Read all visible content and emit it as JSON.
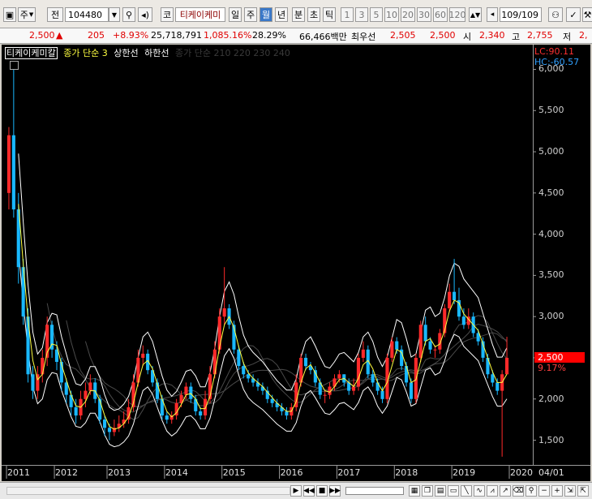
{
  "toolbar": {
    "code_type": "주",
    "market": "전",
    "stock_code": "104480",
    "name_type": "코",
    "stock_name": "티케이케미",
    "periods": [
      "일",
      "주",
      "월",
      "년",
      "분",
      "초",
      "틱"
    ],
    "selected_period": "월",
    "minute_options": [
      "1",
      "3",
      "5",
      "10",
      "20",
      "30",
      "60",
      "120"
    ],
    "count": "109",
    "count_total": "/109"
  },
  "quote": {
    "price": "2,500",
    "arrow": "▲",
    "change": "205",
    "change_pct": "+8.93%",
    "volume": "25,718,791",
    "volume_ratio": "1,085.16%",
    "turnover": "28.29%",
    "amount": "66,466백만",
    "label_lowest": "최우선",
    "bid": "2,505",
    "ask": "2,500",
    "label_open": "시",
    "open": "2,340",
    "label_high": "고",
    "high": "2,755",
    "label_low": "저",
    "low": "2,"
  },
  "legend": {
    "stock": "티케이케미칼",
    "ma_label": "종가 단순 3",
    "upper": "상한선",
    "lower": "하한선",
    "ma_group": "종가 단순 210 220 230 240"
  },
  "indicators": {
    "lc": "LC:90.11",
    "hc": "HC:-60.57",
    "price_tag": "2,500",
    "pct_tag": "9.17%"
  },
  "colors": {
    "up": "#ff2a2a",
    "down": "#19b8ff",
    "band": "#ffffff",
    "ma": "#ffff40",
    "price_tag_bg": "#ff0000"
  },
  "footer": {
    "date_label": "04/01"
  },
  "chart_data": {
    "type": "candlestick",
    "ylim": [
      1200,
      6300
    ],
    "y_ticks": [
      "6,000",
      "5,500",
      "5,000",
      "4,500",
      "4,000",
      "3,500",
      "3,000",
      "2,500",
      "2,000",
      "1,500"
    ],
    "y_tick_values": [
      6000,
      5500,
      5000,
      4500,
      4000,
      3500,
      3000,
      2500,
      2000,
      1500
    ],
    "x_labels": [
      "2011",
      "2012",
      "2013",
      "2014",
      "2015",
      "2016",
      "2017",
      "2018",
      "2019",
      "2020"
    ],
    "x_label_index": [
      0,
      10,
      21,
      33,
      45,
      57,
      69,
      81,
      93,
      105
    ],
    "open": [
      4500,
      5200,
      4300,
      3600,
      3000,
      2300,
      2100,
      2300,
      2500,
      2900,
      2600,
      2450,
      2200,
      2050,
      1900,
      1800,
      2000,
      2100,
      2200,
      2000,
      1750,
      1650,
      1600,
      1650,
      1700,
      1750,
      1900,
      2200,
      2500,
      2550,
      2350,
      2200,
      2000,
      1800,
      1750,
      1800,
      1950,
      2050,
      2150,
      2000,
      1850,
      1800,
      2000,
      2300,
      2600,
      3000,
      3100,
      2900,
      2600,
      2400,
      2300,
      2250,
      2200,
      2150,
      2100,
      2000,
      1950,
      1900,
      1850,
      1800,
      1900,
      2200,
      2500,
      2400,
      2350,
      2200,
      2050,
      2050,
      2150,
      2250,
      2300,
      2200,
      2100,
      2150,
      2500,
      2600,
      2300,
      2200,
      2100,
      2000,
      2500,
      2700,
      2600,
      2400,
      2200,
      2000,
      2500,
      2900,
      2700,
      2600,
      2600,
      2800,
      3100,
      3300,
      3200,
      3000,
      2900,
      3000,
      2800,
      2700,
      2500,
      2300,
      2200,
      2100,
      2300
    ],
    "close": [
      5200,
      4300,
      3600,
      3000,
      2300,
      2100,
      2300,
      2500,
      2900,
      2600,
      2450,
      2200,
      2050,
      1900,
      1800,
      2000,
      2100,
      2200,
      2000,
      1750,
      1650,
      1600,
      1650,
      1700,
      1750,
      1900,
      2200,
      2500,
      2550,
      2350,
      2200,
      2000,
      1800,
      1750,
      1800,
      1950,
      2050,
      2150,
      2000,
      1850,
      1800,
      2000,
      2300,
      2600,
      3000,
      3100,
      2900,
      2600,
      2400,
      2300,
      2250,
      2200,
      2150,
      2100,
      2000,
      1950,
      1900,
      1850,
      1800,
      1900,
      2200,
      2500,
      2400,
      2350,
      2200,
      2050,
      2050,
      2150,
      2250,
      2300,
      2200,
      2100,
      2150,
      2500,
      2600,
      2300,
      2200,
      2100,
      2000,
      2500,
      2700,
      2600,
      2400,
      2200,
      2000,
      2500,
      2900,
      2700,
      2600,
      2600,
      2800,
      3100,
      3300,
      3200,
      3000,
      2900,
      3000,
      2800,
      2700,
      2500,
      2300,
      2200,
      2100,
      2300,
      2500
    ],
    "high": [
      5300,
      6000,
      4500,
      3700,
      3100,
      2400,
      2400,
      2600,
      3000,
      2950,
      2700,
      2500,
      2250,
      2100,
      2000,
      2100,
      2200,
      2300,
      2250,
      2050,
      1800,
      1700,
      1750,
      1800,
      1850,
      2000,
      2300,
      2600,
      2650,
      2600,
      2400,
      2250,
      2050,
      1850,
      1850,
      2000,
      2100,
      2200,
      2200,
      2050,
      1900,
      2100,
      2400,
      2700,
      3100,
      3600,
      3150,
      2950,
      2650,
      2450,
      2350,
      2300,
      2250,
      2200,
      2150,
      2050,
      2000,
      1950,
      1900,
      1950,
      2300,
      2550,
      2550,
      2450,
      2400,
      2250,
      2100,
      2200,
      2300,
      2350,
      2300,
      2250,
      2250,
      2550,
      2700,
      2650,
      2350,
      2250,
      2150,
      2550,
      2750,
      2750,
      2650,
      2450,
      2250,
      2550,
      2950,
      3000,
      2750,
      2650,
      2850,
      3150,
      3400,
      3700,
      3350,
      3100,
      3100,
      3050,
      2850,
      2750,
      2550,
      2350,
      2250,
      2350,
      2755
    ],
    "low": [
      4300,
      4200,
      3400,
      2900,
      2200,
      2000,
      2000,
      2200,
      2400,
      2500,
      2350,
      2100,
      1950,
      1800,
      1700,
      1750,
      1900,
      2050,
      1950,
      1700,
      1550,
      1500,
      1550,
      1600,
      1650,
      1700,
      1850,
      2150,
      2400,
      2300,
      2150,
      1950,
      1750,
      1700,
      1700,
      1750,
      1900,
      2000,
      1950,
      1800,
      1750,
      1750,
      1950,
      2250,
      2550,
      2900,
      2850,
      2550,
      2350,
      2250,
      2200,
      2150,
      2100,
      2050,
      1950,
      1900,
      1850,
      1800,
      1750,
      1750,
      1850,
      2150,
      2350,
      2300,
      2150,
      2000,
      1950,
      2000,
      2100,
      2200,
      2150,
      2050,
      2050,
      2100,
      2450,
      2250,
      2150,
      2050,
      1950,
      1950,
      2450,
      2550,
      2350,
      2150,
      1950,
      1950,
      2450,
      2650,
      2550,
      2500,
      2550,
      2750,
      3050,
      3150,
      2950,
      2850,
      2850,
      2750,
      2650,
      2450,
      2250,
      2150,
      2050,
      1300,
      2300
    ]
  }
}
